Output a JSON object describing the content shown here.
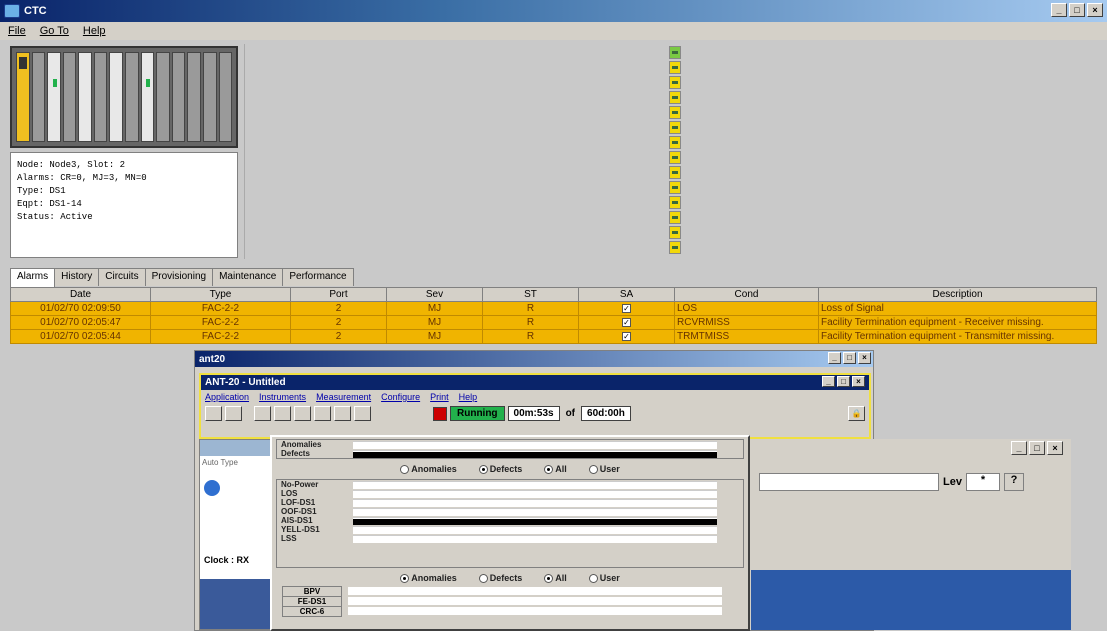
{
  "window": {
    "title": "CTC"
  },
  "menu": [
    "File",
    "Go To",
    "Help"
  ],
  "node_info": {
    "lines": [
      "Node: Node3, Slot: 2",
      "Alarms: CR=0, MJ=3, MN=0",
      "Type: DS1",
      "Eqpt: DS1-14",
      "Status: Active"
    ]
  },
  "tabs": [
    "Alarms",
    "History",
    "Circuits",
    "Provisioning",
    "Maintenance",
    "Performance"
  ],
  "alarm_table": {
    "headers": [
      "Date",
      "Type",
      "Port",
      "Sev",
      "ST",
      "SA",
      "Cond",
      "Description"
    ],
    "rows": [
      [
        "01/02/70 02:09:50",
        "FAC-2-2",
        "2",
        "MJ",
        "R",
        "✓",
        "LOS",
        "Loss of Signal"
      ],
      [
        "01/02/70 02:05:47",
        "FAC-2-2",
        "2",
        "MJ",
        "R",
        "✓",
        "RCVRMISS",
        "Facility Termination equipment - Receiver missing."
      ],
      [
        "01/02/70 02:05:44",
        "FAC-2-2",
        "2",
        "MJ",
        "R",
        "✓",
        "TRMTMISS",
        "Facility Termination equipment - Transmitter missing."
      ]
    ]
  },
  "ant20": {
    "outer_title": "ant20",
    "inner_title": "ANT-20 - Untitled",
    "menu": [
      "Application",
      "Instruments",
      "Measurement",
      "Configure",
      "Print",
      "Help"
    ],
    "status": "Running",
    "elapsed": "00m:53s",
    "of_label": "of",
    "total": "60d:00h",
    "clock_label": "Clock : RX",
    "lev_label": "Lev",
    "lev_value": "*",
    "help_glyph": "?",
    "signal_menu": [
      "Auto",
      "Type"
    ]
  },
  "defects_panel": {
    "top_rows": [
      "Anomalies",
      "Defects"
    ],
    "radio1": {
      "anomalies": "Anomalies",
      "defects": "Defects",
      "all": "All",
      "user": "User"
    },
    "defect_rows": [
      "No-Power",
      "LOS",
      "LOF-DS1",
      "OOF-DS1",
      "AIS-DS1",
      "YELL-DS1",
      "LSS"
    ],
    "radio2": {
      "anomalies": "Anomalies",
      "defects": "Defects",
      "all": "All",
      "user": "User"
    },
    "anomaly_rows": [
      "BPV",
      "FE-DS1",
      "CRC-6"
    ]
  }
}
